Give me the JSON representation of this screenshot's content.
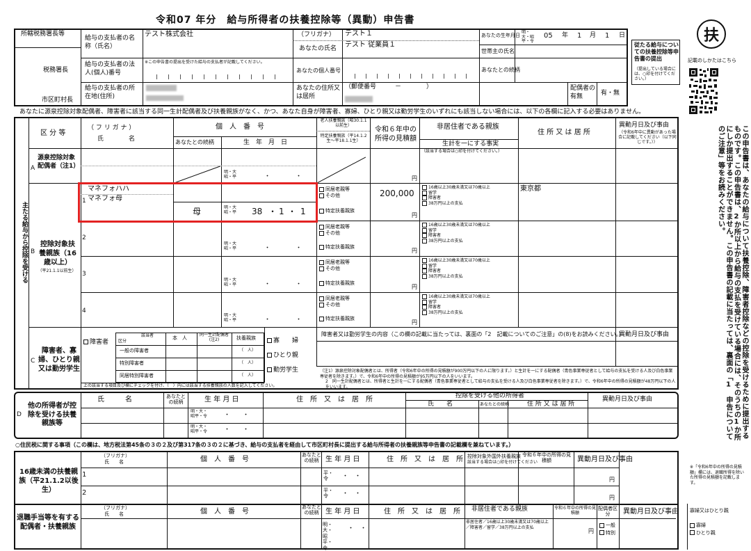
{
  "title": "令和07 年分　給与所得者の扶養控除等（異動）申告書",
  "badge": "扶",
  "qr_caption": "記載のしかたはこちら",
  "header": {
    "office_label": "所轄税務署長等",
    "tax_office_label": "税務署長",
    "city_label": "市区町村長",
    "payer_name_label": "給与の支払者の名称（氏名）",
    "payer_name_value": "テスト株式会社",
    "payer_number_label": "給与の支払者の法人(個人)番号",
    "payer_number_note": "※この申告書の提出を受けた給与の支払者が記載してください。",
    "payer_address_label": "給与の支払者の所在地(住所)",
    "furigana_label": "（フリガナ）",
    "furigana_value": "テスト１",
    "your_name_label": "あなたの氏名",
    "your_name_value": "テスト 従業員１",
    "birthdate_label": "あなたの生年月日",
    "era_options": "明・大・昭平・令",
    "birth_year": "05",
    "birth_month": "1",
    "birth_day": "1",
    "year_unit": "年",
    "month_unit": "月",
    "day_unit": "日",
    "household_head_label": "世帯主の氏名",
    "relation_label": "あなたとの続柄",
    "your_number_label": "あなたの個人番号",
    "your_address_label": "あなたの住所又は居所",
    "postal_label": "（郵便番号　　　－　　　　）",
    "spouse_label": "配偶者の有無",
    "spouse_value": "有・無",
    "submission_note": "従たる給与についての扶養控除等申告書の提出",
    "submission_sub": "（提出している場合には、○印を付けてください。）"
  },
  "notice": "あなたに源泉控除対象配偶者、障害者に該当する同一生計配偶者及び扶養親族がなく、かつ、あなた自身が障害者、寡婦、ひとり親又は勤労学生のいずれにも該当しない場合には、以下の各欄に記入する必要はありません。",
  "main": {
    "side_label": "主たる給与から控除を受ける",
    "col_category": "区 分 等",
    "col_furigana": "（ フ リ ガ ナ ）",
    "col_name": "氏　　　　名",
    "col_mynumber": "個　人　番　号",
    "col_relation": "あなたとの続柄",
    "col_birthdate": "生　年　月　日",
    "col_elder": "老人扶養親族（昭30.1.1以前生）",
    "col_specific": "特定扶養親族（平14.1.2生〜平18.1.1生）",
    "col_income": "令和６年中の所得の見積額",
    "col_nonresident": "非居住者である親族",
    "col_nonresident_sub": "生計を一にする事実",
    "col_nonresident_note": "（該当する場合は○印を付けてください。）",
    "col_address": "住 所 又 は 居 所",
    "col_change": "異動月日及び事由",
    "col_change_note": "（令和6年中に異動があった場合に記載してください（以下同じです。））",
    "row_a_label": "源泉控除対象配偶者（注1）",
    "row_b_label": "控除対象扶養親族（16歳以上）",
    "row_b_sub": "（平21.1.1以前生）",
    "era_small": "明・大昭・平",
    "opt_cohabit": "同居老親等",
    "opt_other": "その他",
    "opt_specific": "特定扶養親族",
    "opt_nr1": "16歳以上30歳未満又は70歳以上",
    "opt_nr2": "留学",
    "opt_nr3": "障害者",
    "opt_nr4": "38万円以上の支払",
    "yen": "円",
    "dependent1": {
      "furigana": "マネフォハハ",
      "name": "マネフォ母",
      "relation": "母",
      "era": "明・大昭・平",
      "year": "38",
      "month": "1",
      "day": "1",
      "income": "200,000",
      "address": "東京都"
    }
  },
  "section_c": {
    "label": "障害者、寡婦、ひとり親又は勤労学生",
    "disabled": "障害者",
    "category": "区分",
    "applicant": "該当者",
    "self": "本　人",
    "same_spouse": "同一生計配偶者(注2)",
    "dependent": "扶養親族",
    "general": "一般の障害者",
    "special": "特別障害者",
    "cohabit_special": "同居特別障害者",
    "people": "（　人）",
    "widow": "寡　　婦",
    "single": "ひとり親",
    "student": "勤労学生",
    "check_note": "上の該当する項目及び欄にチェックを付け、（　）内には該当する扶養親族の人数を記入してください。",
    "detail_label": "障害者又は勤労学生の内容（この欄の記載に当たっては、裏面の「2　記載についてのご注意」の(8)をお読みください。）",
    "change_label": "異動月日及び事由",
    "note1": "（注1）源泉控除対象配偶者とは、所得者（令和6年中の所得の見積額が900万円以下の人に限ります。）と生計を一にする配偶者（青色事業専従者として給与の支払を受ける人及び白色事業専従者を除きます。）で、令和6年中の所得の見積額が95万円以下の人をいいます。",
    "note2": "2　同一生計配偶者とは、所得者と生計を一にする配偶者（青色事業専従者として給与の支払を受ける人及び白色事業専従者を除きます。）で、令和6年中の所得の見積額が48万円以下の人をいいます。"
  },
  "section_d": {
    "label": "他の所得者が控除を受ける扶養親族等",
    "name": "氏　　　名",
    "relation": "あなたとの続柄",
    "birthdate": "生 年 月 日",
    "address": "住　所　又　は　居　所",
    "other_taxpayer": "控除を受ける他の所得者",
    "other_name": "氏　　名",
    "other_relation": "あなたとの続柄",
    "other_address": "住 所 又 は 居 所",
    "change": "異動月日及び事由",
    "era1": "明・大・昭平・令",
    "era2": "明・大・昭平・令"
  },
  "resident": {
    "heading": "○住民税に関する事項（この欄は、地方税法第45条の３の２及び第317条の３の２に基づき、給与の支払者を経由して市区町村長に提出する給与所得者の扶養親族等申告書の記載欄を兼ねています。）",
    "under16_label": "16歳未満の扶養親族（平21.1.2以後生）",
    "furigana": "（フリガナ）",
    "name": "氏　　名",
    "mynumber": "個　人　番　号",
    "relation": "あなたとの続柄",
    "birthdate": "生 年 月 日",
    "address": "住　所　又　は　居　所",
    "nonresident": "控除対象外国外扶養親族",
    "nonresident_sub": "該当する場合は○印を付けてください",
    "income": "令和６年中の所得の見積額",
    "change": "異動月日及び事由",
    "row1": "1",
    "row2": "2",
    "era": "平・令",
    "side_note": "※「令和6年中の所得の見積額」欄には、退職所得を除いた所得の見積額を記載します。",
    "retire_label": "退職手当等を有する配偶者・扶養親族",
    "nr_relative": "非居住者である親族",
    "spouse_cat": "配偶者区分",
    "general": "一般",
    "special": "特別",
    "widow_single": "寡婦又はひとり親",
    "widow": "寡婦",
    "single": "ひとり親",
    "nr_options": "非居住者／16歳以上30歳未満又は70歳以上／障害者／留学／38万円以上の支払",
    "era_long": "明・大・昭平・令"
  },
  "right_column": "この申告書は、あなたの給与について扶養控除、障害者控除などの控除を受けるために提出するものです。この申告書は、2か所以上から給与の支払を受けている場合には、そのうちの1か所にしか提出することができません。この申告書の記載に当たっては、裏面の「1　申告についてのご注意」等をお読みください。",
  "colors": {
    "highlight": "#e32222",
    "redaction": "#bdbdbd"
  }
}
